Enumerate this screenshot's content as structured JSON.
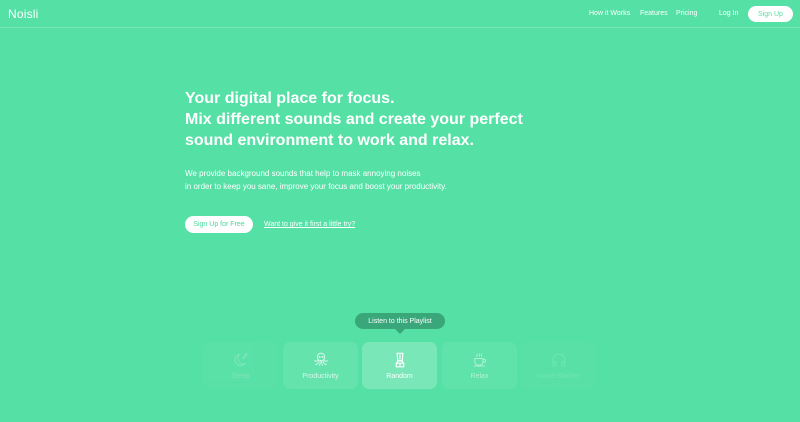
{
  "header": {
    "logo": "Noisli",
    "nav": {
      "how_it_works": "How it Works",
      "features": "Features",
      "pricing": "Pricing",
      "login": "Log In"
    },
    "signup": "Sign Up"
  },
  "hero": {
    "headline_lines": [
      "Your digital place for focus.",
      "Mix different sounds and create your perfect",
      "sound environment to work and relax."
    ],
    "description_lines": [
      "We provide background sounds that help to mask annoying noises",
      "in order to keep you sane, improve your focus and boost your productivity."
    ],
    "cta_signup": "Sign Up for Free",
    "cta_try": "Want to give it first a little try?"
  },
  "playlist": {
    "tooltip": "Listen to this Playlist",
    "cards": [
      {
        "label": "Sleep",
        "icon": "moon-icon"
      },
      {
        "label": "Productivity",
        "icon": "octopus-icon"
      },
      {
        "label": "Random",
        "icon": "blender-icon"
      },
      {
        "label": "Relax",
        "icon": "tea-cup-icon"
      },
      {
        "label": "Noise Blocker",
        "icon": "headphones-icon"
      }
    ]
  },
  "colors": {
    "background": "#55e0a5",
    "accent_dark": "#3aa77a",
    "text": "#ffffff"
  }
}
